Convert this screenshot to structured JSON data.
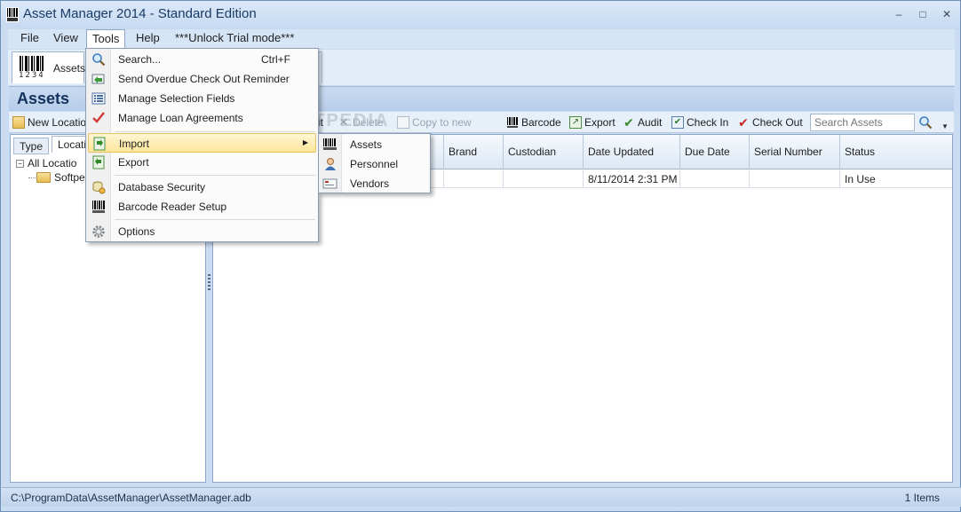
{
  "window": {
    "title": "Asset Manager 2014 - Standard Edition",
    "controls": {
      "minimize": "–",
      "maximize": "□",
      "close": "✕"
    }
  },
  "menubar": {
    "items": [
      "File",
      "View",
      "Tools",
      "Help",
      "***Unlock Trial mode***"
    ],
    "active": "Tools"
  },
  "main_tabs": {
    "assets_label": "Assets",
    "assets_barcode_digits": "1234"
  },
  "header": {
    "title": "Assets"
  },
  "toolbar": {
    "new_location": "New Locatio",
    "edit": "it",
    "delete": "Delete",
    "copy_to_new": "Copy to new",
    "barcode": "Barcode",
    "export": "Export",
    "audit": "Audit",
    "check_in": "Check In",
    "check_out": "Check Out",
    "search_placeholder": "Search Assets"
  },
  "left_pane": {
    "tabs": [
      "Type",
      "Locatio"
    ],
    "tree": [
      {
        "label": "All Locatio",
        "expander": "−"
      },
      {
        "label": "Softpec"
      }
    ]
  },
  "grid": {
    "columns": [
      "Brand",
      "Custodian",
      "Date Updated",
      "Due Date",
      "Serial Number",
      "Status"
    ],
    "rows": [
      {
        "Brand": "",
        "Custodian": "",
        "Date Updated": "8/11/2014 2:31 PM",
        "Due Date": "",
        "Serial Number": "",
        "Status": "In Use"
      }
    ]
  },
  "watermark": "SOFTPEDIA",
  "tools_menu": {
    "items": [
      {
        "label": "Search...",
        "shortcut": "Ctrl+F",
        "icon": "search-icon"
      },
      {
        "label": "Send Overdue Check Out Reminder",
        "icon": "reminder-icon"
      },
      {
        "label": "Manage Selection Fields",
        "icon": "list-icon"
      },
      {
        "label": "Manage Loan Agreements",
        "icon": "checkmark-icon"
      },
      {
        "label": "Import",
        "icon": "import-icon",
        "submenu": true
      },
      {
        "label": "Export",
        "icon": "export-icon"
      },
      {
        "label": "Database Security",
        "icon": "database-security-icon"
      },
      {
        "label": "Barcode Reader Setup",
        "icon": "barcode-icon"
      },
      {
        "label": "Options",
        "icon": "gear-icon"
      }
    ],
    "highlighted": "Import"
  },
  "import_submenu": {
    "items": [
      {
        "label": "Assets",
        "icon": "barcode-icon"
      },
      {
        "label": "Personnel",
        "icon": "person-icon"
      },
      {
        "label": "Vendors",
        "icon": "vendor-card-icon"
      }
    ]
  },
  "statusbar": {
    "path": "C:\\ProgramData\\AssetManager\\AssetManager.adb",
    "count": "1 Items"
  },
  "colors": {
    "chrome": "#c9dcf1",
    "header_text": "#15325c",
    "menu_highlight": "#fde59a"
  }
}
